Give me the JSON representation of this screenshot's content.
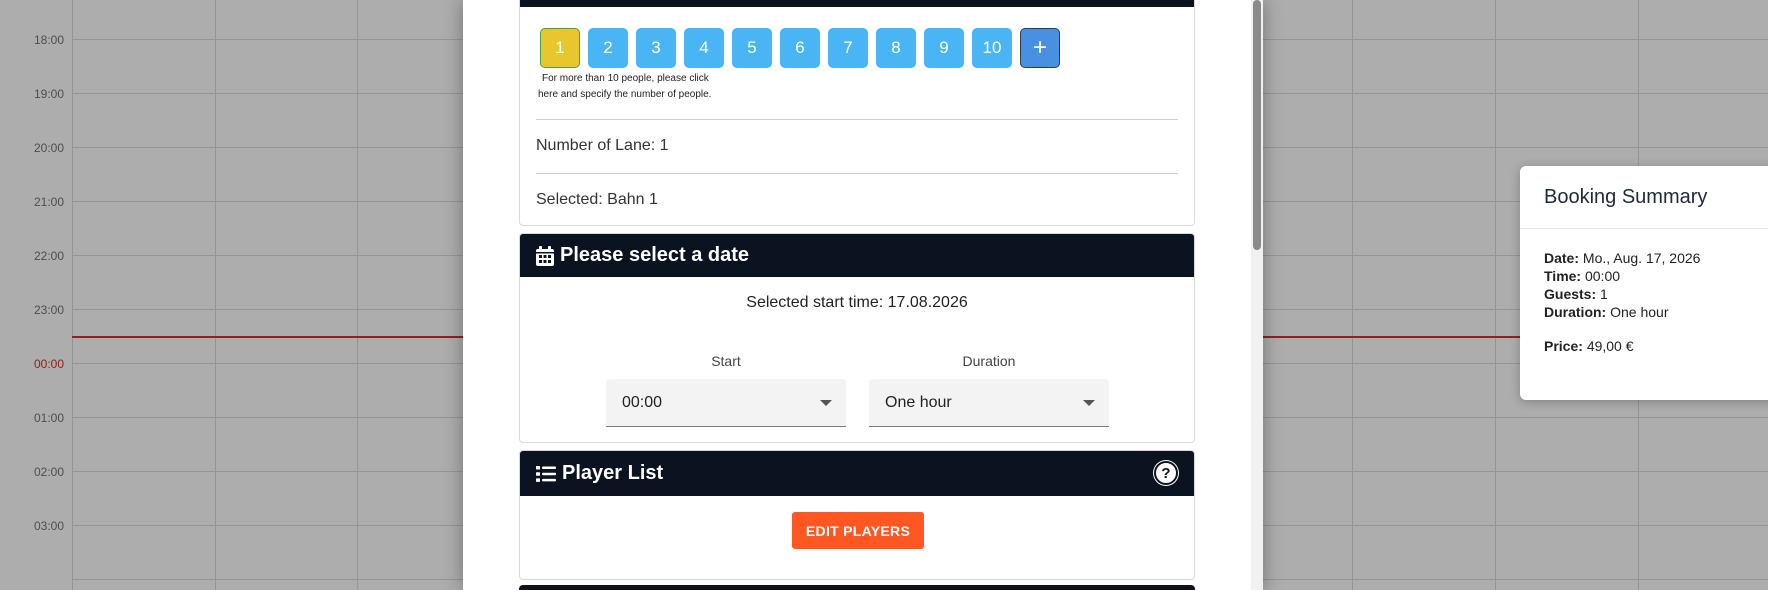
{
  "calendar": {
    "times": [
      "18:00",
      "19:00",
      "20:00",
      "21:00",
      "22:00",
      "23:00",
      "00:00",
      "01:00",
      "02:00",
      "03:00"
    ]
  },
  "modal": {
    "people": {
      "buttons": [
        "1",
        "2",
        "3",
        "4",
        "5",
        "6",
        "7",
        "8",
        "9",
        "10"
      ],
      "selected": "1",
      "more_button": "+",
      "note_line1": "For more than 10 people, please click",
      "note_line2": "here and specify the number of people.",
      "number_of_lane": "Number of Lane: 1",
      "selected_lane": "Selected: Bahn 1"
    },
    "date_section": {
      "title": "Please select a date",
      "selected_start": "Selected start time: 17.08.2026",
      "start_label": "Start",
      "start_value": "00:00",
      "duration_label": "Duration",
      "duration_value": "One hour"
    },
    "player_section": {
      "title": "Player List",
      "help": "?",
      "edit_button": "EDIT PLAYERS"
    }
  },
  "summary": {
    "title": "Booking Summary",
    "date_label": "Date:",
    "date_value": "Mo., Aug. 17, 2026",
    "time_label": "Time:",
    "time_value": "00:00",
    "guests_label": "Guests:",
    "guests_value": "1",
    "duration_label": "Duration:",
    "duration_value": "One hour",
    "price_label": "Price:",
    "price_value": "49,00 €"
  },
  "colors": {
    "header": "#0b1321",
    "people_button": "#4ab5f5",
    "people_selected": "#e8c72c",
    "edit_button": "#ff5722",
    "now_line": "#d93025"
  }
}
